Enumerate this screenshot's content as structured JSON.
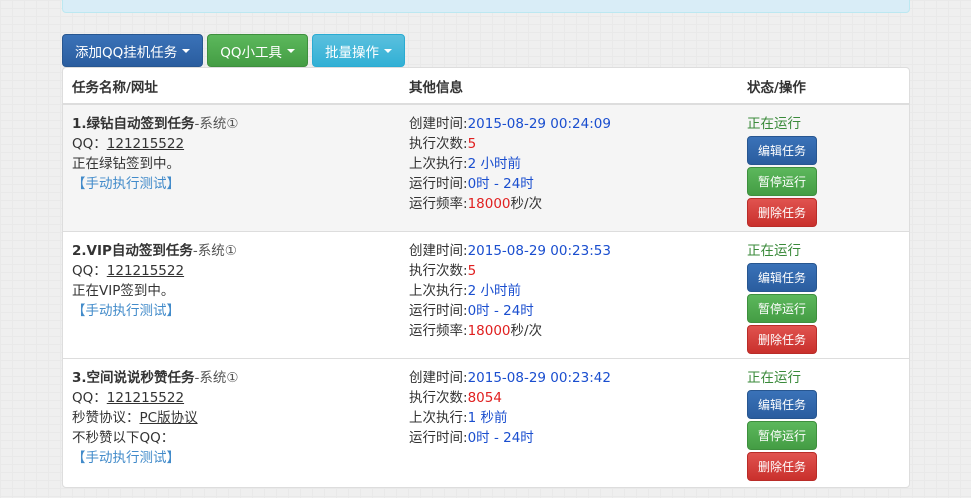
{
  "toolbar": {
    "add_task": "添加QQ挂机任务",
    "qq_tools": "QQ小工具",
    "batch_ops": "批量操作"
  },
  "table": {
    "headers": {
      "name": "任务名称/网址",
      "info": "其他信息",
      "status": "状态/操作"
    }
  },
  "labels": {
    "qq": "QQ：",
    "created": "创建时间:",
    "exec_count": "执行次数:",
    "last_exec": "上次执行:",
    "run_time": "运行时间:",
    "run_freq": "运行频率:",
    "freq_unit": "秒/次",
    "manual_test": "【手动执行测试】",
    "protocol": "秒赞协议：",
    "exclude": "不秒赞以下QQ：",
    "edit": "编辑任务",
    "pause": "暂停运行",
    "delete": "删除任务"
  },
  "tasks": [
    {
      "title": "1.绿钻自动签到任务",
      "system": "-系统①",
      "qq": "121215522",
      "desc": "正在绿钻签到中。",
      "created": "2015-08-29 00:24:09",
      "exec_count": "5",
      "last_exec_num": "2",
      "last_exec_unit": " 小时前",
      "run_start": "0时",
      "run_end": " - 24时",
      "freq": "18000",
      "status": "正在运行"
    },
    {
      "title": "2.VIP自动签到任务",
      "system": "-系统①",
      "qq": "121215522",
      "desc": "正在VIP签到中。",
      "created": "2015-08-29 00:23:53",
      "exec_count": "5",
      "last_exec_num": "2",
      "last_exec_unit": " 小时前",
      "run_start": "0时",
      "run_end": " - 24时",
      "freq": "18000",
      "status": "正在运行"
    },
    {
      "title": "3.空间说说秒赞任务",
      "system": "-系统①",
      "qq": "121215522",
      "protocol_value": "PC版协议",
      "created": "2015-08-29 00:23:42",
      "exec_count": "8054",
      "last_exec_num": "1",
      "last_exec_unit": " 秒前",
      "run_start": "0时",
      "run_end": " - 24时",
      "status": "正在运行"
    }
  ],
  "colors": {
    "primary": "#2a5d9f",
    "success": "#449d44",
    "info": "#31b0d5",
    "danger": "#c9302c",
    "value_blue": "#1a4ecf",
    "value_red": "#e02020",
    "status_green": "#3a8a3a"
  }
}
